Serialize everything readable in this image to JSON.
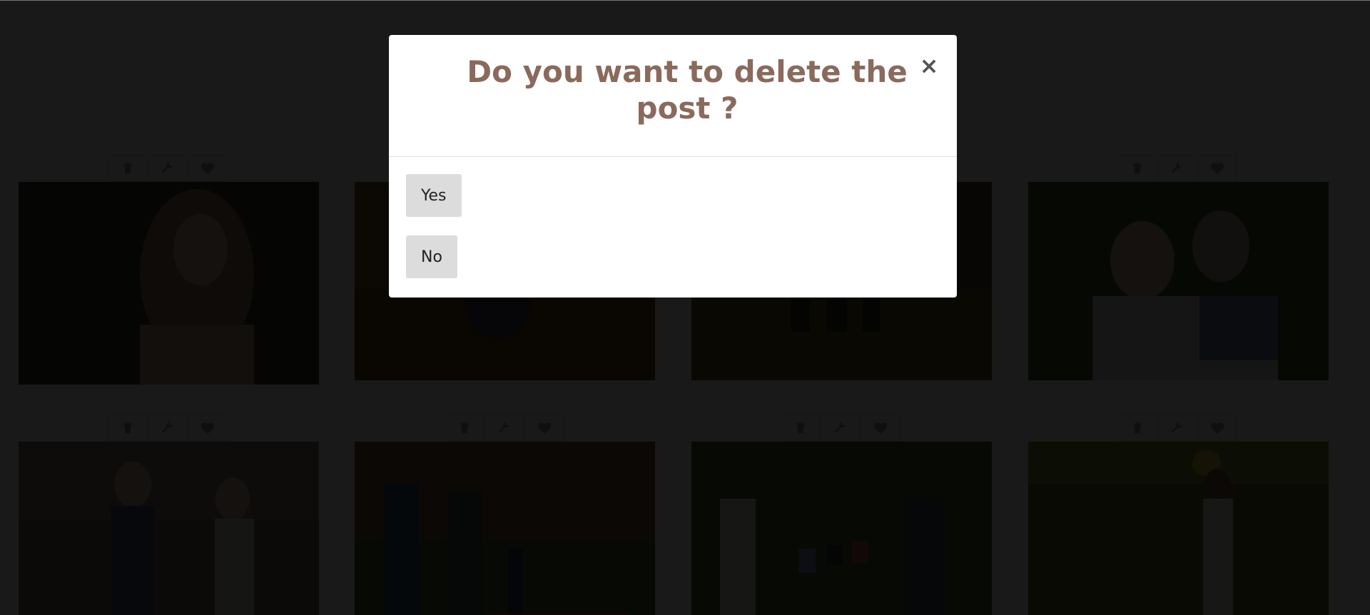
{
  "modal": {
    "title": "Do you want to delete the post ?",
    "close_label": "×",
    "yes_label": "Yes",
    "no_label": "No"
  },
  "gallery": {
    "card_actions": [
      {
        "icon": "trash-icon"
      },
      {
        "icon": "wrench-icon"
      },
      {
        "icon": "heart-icon"
      }
    ]
  },
  "colors": {
    "title": "#8a6a5c",
    "backdrop": "rgba(0,0,0,0.9)",
    "button_bg": "#dcdcdc"
  }
}
